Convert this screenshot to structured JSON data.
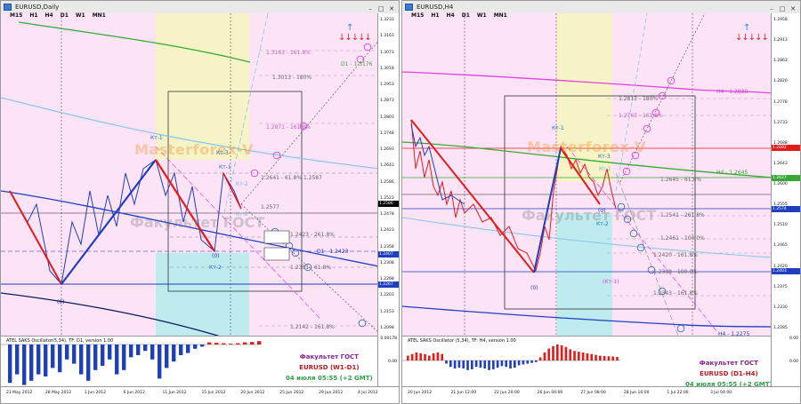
{
  "colors": {
    "background_pink": "#fde3f6",
    "yellow_zone": "#f6f3c6",
    "cyan_zone": "#bdebee",
    "blue_line": "#1f3fbf",
    "red_line": "#e21b1b",
    "green_line": "#36a836",
    "magenta_line": "#e040e0",
    "skyblue_line": "#87c6ea",
    "navy_line": "#0b1a63"
  },
  "left": {
    "title": "EURUSD,Daily",
    "timeframes": [
      "M15",
      "H1",
      "H4",
      "D1",
      "W1",
      "MN1"
    ],
    "watermark_top": "Masterforex-V",
    "watermark_bottom": "Факультет ГОСТ",
    "labels": {
      "kt1": "Кт-1",
      "kt3": "Кт-3",
      "kt1b": "Кт-1",
      "kt2a": "Кт-2",
      "kt2b": "Кт-2",
      "zero_a": "(0)",
      "zero_b": "(0)",
      "kt2c": "Кт-2",
      "d1": "D1 - 1.3176",
      "d1b": "D1 - 1.2423",
      "f1": "1.3163 - 161.8%",
      "f2": "1.3013 - 180%",
      "f3": "1.2871 - 161.8%",
      "f4": "1.2641 - 61.8% 1.2587",
      "f5": "1.2577",
      "f6": "1.2423 - 261.8%",
      "f7": "1.2351 - 61.8%",
      "f8": "1.2142 - 161.8%"
    },
    "price_axis": [
      "1.3233",
      "1.3163",
      "1.3073",
      "1.3018",
      "1.2953",
      "1.2873",
      "1.2803",
      "1.2748",
      "1.2693",
      "1.2643",
      "1.2586",
      "1.2523",
      "1.2478",
      "1.2423",
      "1.2358",
      "1.2308",
      "1.2268",
      "1.2203",
      "1.2153",
      "1.2098"
    ],
    "price_tags": [
      {
        "text": "1.2586",
        "color": "#000000"
      },
      {
        "text": "1.2407",
        "color": "#1f3fbf"
      },
      {
        "text": "1.2267",
        "color": "#1f3fbf"
      }
    ],
    "time_axis": [
      "23 May 2012",
      "28 May 2012",
      "1 Jun 2012",
      "6 Jun 2012",
      "11 Jun 2012",
      "15 Jun 2012",
      "20 Jun 2012",
      "25 Jun 2012",
      "29 Jun 2012",
      "4 Jul 2012"
    ],
    "osc_label": "ATEL SAKS Oscillator(5,34), TF: D1, version 1.00",
    "osc_axis": [
      "0.00178",
      "0.00"
    ],
    "osc_values": [
      -0.9,
      -0.7,
      -0.95,
      -0.85,
      -0.7,
      -0.75,
      -0.55,
      -0.65,
      -0.35,
      -0.45,
      -0.7,
      -0.85,
      -0.6,
      -0.5,
      -0.35,
      -0.7,
      -0.6,
      -0.3,
      -0.25,
      -0.15,
      -0.35,
      -0.8,
      -0.55,
      -0.4,
      -0.25,
      -0.2,
      -0.1,
      -0.05,
      0.05,
      0.04,
      0.03,
      0.02,
      0.03,
      0.05,
      0.06,
      0.08
    ],
    "footer": {
      "line1": "Факультет ГОСТ",
      "line2": "EURUSD (W1-D1)",
      "line3": "04 июля 05:55 (+2 GMT)"
    }
  },
  "right": {
    "title": "EURUSD,H4",
    "timeframes": [
      "M15",
      "H1",
      "H4",
      "D1",
      "W1",
      "MN1"
    ],
    "watermark_top": "Masterforex-V",
    "watermark_bottom": "Факультет ГОСТ",
    "labels": {
      "kt1": "Кт-1",
      "kt3": "Кт-3",
      "kt1b": "Кт-1",
      "kt2": "Кт-2",
      "zero_a": "(0)",
      "zero_b": "(0)",
      "kt1c": "(Кт-1)",
      "h4a": "H4 - 1.2839",
      "h4b": "H4 - 1.2645",
      "h4c": "H4 - 1.2275",
      "f1": "1.2813 - 180%",
      "f2": "1.2763 - 161.8%",
      "f3": "1.2645 - 61.8%",
      "f4": "1.2541 - 261.8%",
      "f5": "1.2461 - 100.0%",
      "f6": "1.2420 - 161.8%",
      "f7": "1.2388 - 100.0%",
      "f8": "1.2343 - 161.8%"
    },
    "price_axis": [
      "1.2958",
      "1.2913",
      "1.2863",
      "1.2820",
      "1.2778",
      "1.2733",
      "1.2688",
      "1.2643",
      "1.2600",
      "1.2555",
      "1.2510",
      "1.2465",
      "1.2420",
      "1.2375",
      "1.2330",
      "1.2285"
    ],
    "price_tags": [
      {
        "text": "1.2692",
        "color": "#e21b1b"
      },
      {
        "text": "1.2627",
        "color": "#36a836"
      },
      {
        "text": "1.2574",
        "color": "#1f3fbf"
      },
      {
        "text": "1.2403",
        "color": "#1f3fbf"
      }
    ],
    "time_axis": [
      "20 Jun 2012",
      "21 Jun 12:00",
      "22 Jun 20:00",
      "26 Jun 04:00",
      "27 Jun 08:00",
      "28 Jun 16:00",
      "1 Jul 22:00",
      "3 Jul 04:00"
    ],
    "osc_label": "ATEL SAKS Oscillator (5,34), TF: H4, version 1.00",
    "osc_axis": [
      "0.00",
      "0.00"
    ],
    "osc_values": [
      0.3,
      0.4,
      0.5,
      0.45,
      0.4,
      0.3,
      0.45,
      0.5,
      0.4,
      -0.2,
      -0.4,
      -0.5,
      -0.45,
      -0.5,
      -0.6,
      -0.55,
      -0.4,
      -0.45,
      -0.5,
      -0.6,
      -0.55,
      -0.45,
      -0.35,
      -0.4,
      -0.5,
      -0.45,
      -0.3,
      -0.25,
      -0.2,
      -0.15,
      -0.1,
      0.2,
      0.5,
      0.75,
      0.9,
      1.0,
      0.95,
      0.85,
      0.7,
      0.6,
      0.55,
      0.5,
      0.45,
      0.4,
      0.35,
      0.3,
      0.28,
      0.26,
      0.25,
      0.22
    ],
    "footer": {
      "line1": "Факультет ГОСТ",
      "line2": "EURUSD (D1-H4)",
      "line3": "04 июля 05:55 (+2 GMT)"
    }
  }
}
